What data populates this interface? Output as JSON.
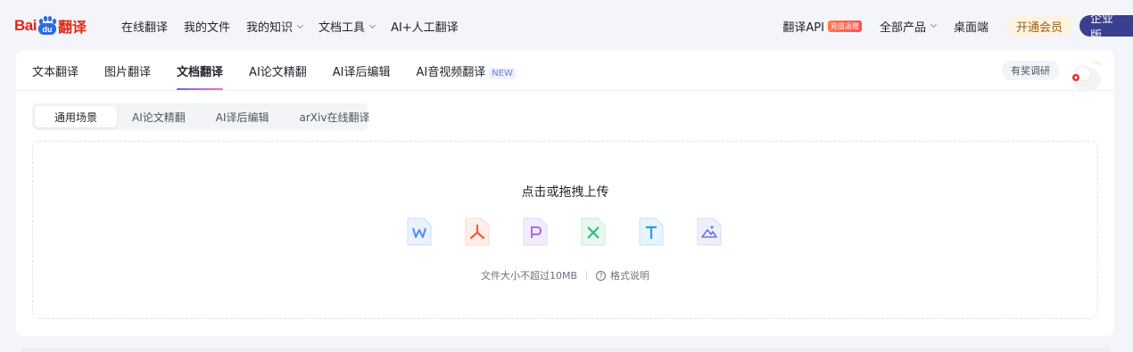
{
  "header": {
    "logo_text_bai": "Bai",
    "logo_text_du": "du",
    "logo_text_fanyi": "翻译",
    "nav": [
      {
        "label": "在线翻译",
        "has_dropdown": false
      },
      {
        "label": "我的文件",
        "has_dropdown": false
      },
      {
        "label": "我的知识",
        "has_dropdown": true
      },
      {
        "label": "文档工具",
        "has_dropdown": true
      },
      {
        "label": "AI+人工翻译",
        "has_dropdown": false
      }
    ],
    "api_label": "翻译API",
    "api_badge": "充值返赠",
    "products_label": "全部产品",
    "desktop_label": "桌面端",
    "vip_label": "开通会员",
    "enterprise_label": "企业版"
  },
  "main": {
    "tabs": [
      {
        "label": "文本翻译",
        "active": false
      },
      {
        "label": "图片翻译",
        "active": false
      },
      {
        "label": "文档翻译",
        "active": true
      },
      {
        "label": "AI论文精翻",
        "active": false
      },
      {
        "label": "AI译后编辑",
        "active": false
      },
      {
        "label": "AI音视频翻译",
        "active": false
      }
    ],
    "new_tag": "NEW",
    "survey_label": "有奖调研",
    "subtabs": [
      {
        "label": "通用场景",
        "active": true
      },
      {
        "label": "AI论文精翻",
        "active": false
      },
      {
        "label": "AI译后编辑",
        "active": false
      },
      {
        "label": "arXiv在线翻译",
        "active": false
      }
    ],
    "upload": {
      "title": "点击或拖拽上传",
      "file_types": [
        {
          "icon": "word-file-icon",
          "letter": "W",
          "color": "#4e8cf7",
          "bg": "#eaf2ff"
        },
        {
          "icon": "pdf-file-icon",
          "letter": "pdf",
          "color": "#f5573b",
          "bg": "#ffefea"
        },
        {
          "icon": "ppt-file-icon",
          "letter": "P",
          "color": "#a36cf0",
          "bg": "#f3ecff"
        },
        {
          "icon": "excel-file-icon",
          "letter": "X",
          "color": "#2fb87a",
          "bg": "#e7f8ef"
        },
        {
          "icon": "text-file-icon",
          "letter": "T",
          "color": "#2b9de8",
          "bg": "#e6f4fd"
        },
        {
          "icon": "image-file-icon",
          "letter": "img",
          "color": "#6b72e6",
          "bg": "#eeeffd"
        }
      ],
      "size_hint": "文件大小不超过10MB",
      "format_help": "格式说明"
    }
  }
}
